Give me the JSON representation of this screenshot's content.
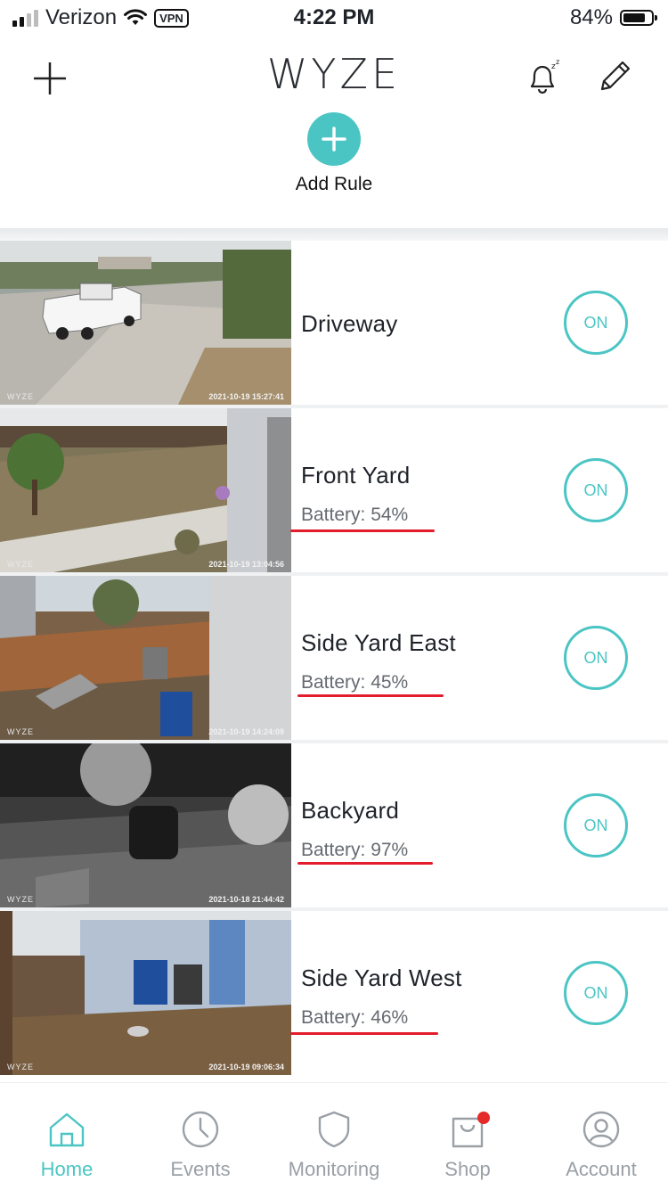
{
  "status_bar": {
    "carrier": "Verizon",
    "vpn": "VPN",
    "time": "4:22 PM",
    "battery_percent": "84%",
    "battery_level": 0.84
  },
  "header": {
    "logo": "WYZE",
    "add_rule_label": "Add Rule"
  },
  "cameras": [
    {
      "name": "Driveway",
      "battery": "",
      "toggle": "ON",
      "watermark": "WYZE",
      "timestamp": "2021-10-19 15:27:41"
    },
    {
      "name": "Front Yard",
      "battery": "Battery: 54%",
      "toggle": "ON",
      "watermark": "WYZE",
      "timestamp": "2021-10-19 13:04:56"
    },
    {
      "name": "Side Yard East",
      "battery": "Battery: 45%",
      "toggle": "ON",
      "watermark": "WYZE",
      "timestamp": "2021-10-19 14:24:09"
    },
    {
      "name": "Backyard",
      "battery": "Battery: 97%",
      "toggle": "ON",
      "watermark": "WYZE",
      "timestamp": "2021-10-18 21:44:42"
    },
    {
      "name": "Side Yard West",
      "battery": "Battery: 46%",
      "toggle": "ON",
      "watermark": "WYZE",
      "timestamp": "2021-10-19 09:06:34"
    }
  ],
  "tabs": [
    {
      "label": "Home",
      "icon": "home-icon",
      "active": true
    },
    {
      "label": "Events",
      "icon": "clock-icon",
      "active": false
    },
    {
      "label": "Monitoring",
      "icon": "shield-icon",
      "active": false
    },
    {
      "label": "Shop",
      "icon": "shopping-bag-icon",
      "active": false,
      "badge": true
    },
    {
      "label": "Account",
      "icon": "user-icon",
      "active": false
    }
  ],
  "colors": {
    "accent": "#4bc5c4",
    "annotation": "#e21c2b",
    "badge": "#e52a2a"
  }
}
